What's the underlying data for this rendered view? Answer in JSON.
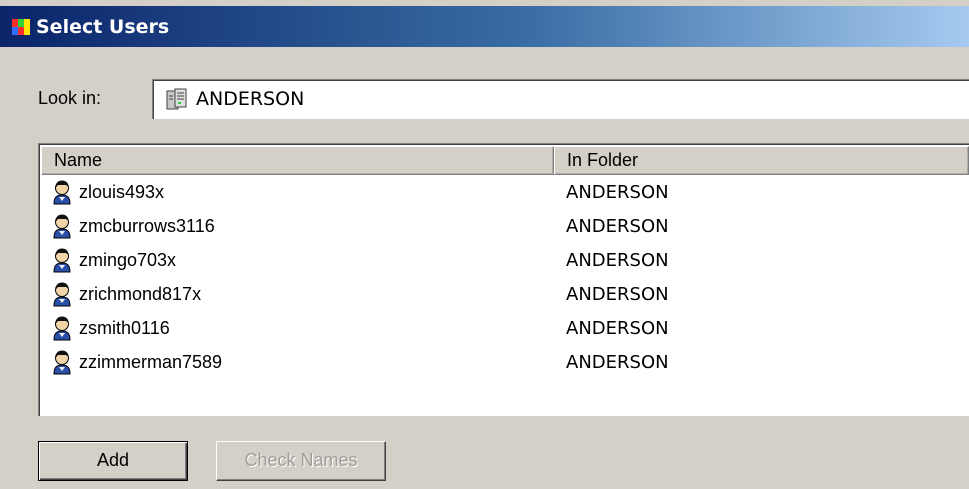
{
  "window": {
    "title": "Select Users",
    "icon": "app-icon"
  },
  "look_in": {
    "label": "Look in:",
    "value": "ANDERSON",
    "icon": "server-icon"
  },
  "list": {
    "columns": [
      "Name",
      "In Folder"
    ],
    "rows": [
      {
        "name": "zlouis493x",
        "folder": "ANDERSON",
        "icon": "user-icon"
      },
      {
        "name": "zmcburrows3116",
        "folder": "ANDERSON",
        "icon": "user-icon"
      },
      {
        "name": "zmingo703x",
        "folder": "ANDERSON",
        "icon": "user-icon"
      },
      {
        "name": "zrichmond817x",
        "folder": "ANDERSON",
        "icon": "user-icon"
      },
      {
        "name": "zsmith0116",
        "folder": "ANDERSON",
        "icon": "user-icon"
      },
      {
        "name": "zzimmerman7589",
        "folder": "ANDERSON",
        "icon": "user-icon"
      }
    ]
  },
  "buttons": {
    "add": "Add",
    "check_names": "Check Names",
    "check_names_enabled": false
  },
  "colors": {
    "titlebar_start": "#0a246a",
    "titlebar_end": "#a6caf0",
    "face": "#d4d0c8"
  }
}
